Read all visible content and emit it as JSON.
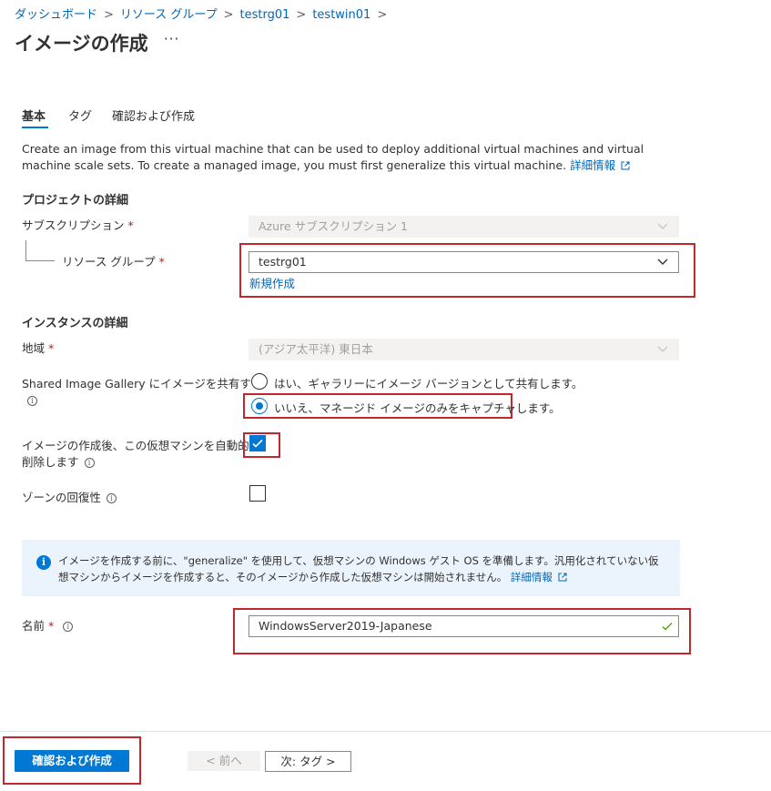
{
  "breadcrumb": {
    "items": [
      "ダッシュボード",
      "リソース グループ",
      "testrg01",
      "testwin01"
    ],
    "separator": ">"
  },
  "header": {
    "title": "イメージの作成",
    "more": "···"
  },
  "tabs": [
    {
      "label": "基本",
      "active": true
    },
    {
      "label": "タグ",
      "active": false
    },
    {
      "label": "確認および作成",
      "active": false
    }
  ],
  "description": {
    "text": "Create an image from this virtual machine that can be used to deploy additional virtual machines and virtual machine scale sets. To create a managed image, you must first generalize this virtual machine.",
    "link": "詳細情報"
  },
  "project": {
    "heading": "プロジェクトの詳細",
    "subscription_label": "サブスクリプション",
    "subscription_value": "Azure サブスクリプション 1",
    "rg_label": "リソース グループ",
    "rg_value": "testrg01",
    "rg_create_new": "新規作成"
  },
  "instance": {
    "heading": "インスタンスの詳細",
    "region_label": "地域",
    "region_value": "(アジア太平洋) 東日本",
    "gallery_label": "Shared Image Gallery にイメージを共有する",
    "gallery_option_yes": "はい、ギャラリーにイメージ バージョンとして共有します。",
    "gallery_option_no": "いいえ、マネージド イメージのみをキャプチャします。",
    "autodelete_label_line1": "イメージの作成後、この仮想マシンを自動的に",
    "autodelete_label_line2": "削除します",
    "zone_label": "ゾーンの回復性"
  },
  "infobox": {
    "text": "イメージを作成する前に、\"generalize\" を使用して、仮想マシンの Windows ゲスト OS を準備します。汎用化されていない仮想マシンからイメージを作成すると、そのイメージから作成した仮想マシンは開始されません。",
    "link": "詳細情報"
  },
  "name": {
    "label": "名前",
    "value": "WindowsServer2019-Japanese"
  },
  "footer": {
    "review_create": "確認および作成",
    "previous": "< 前へ",
    "next": "次: タグ >"
  },
  "colors": {
    "accent": "#0078d4",
    "highlight_box": "#c4262e",
    "required": "#a4262c"
  },
  "icons": [
    "chevron-right-icon",
    "chevron-down-icon",
    "info-icon",
    "external-link-icon",
    "check-icon",
    "radio-selected-icon"
  ]
}
